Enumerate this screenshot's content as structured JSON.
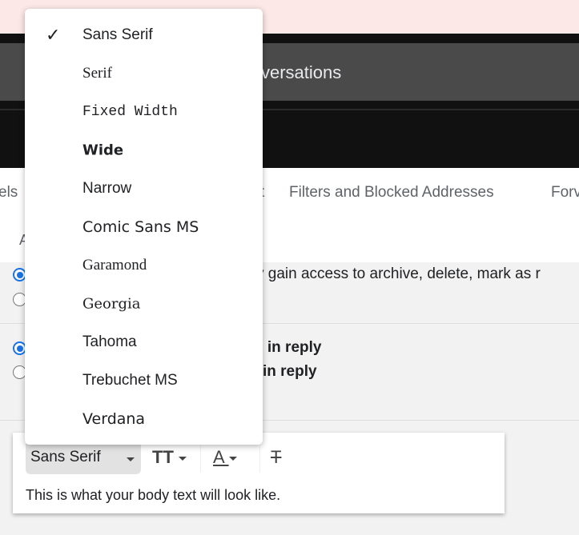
{
  "search": {
    "visible_text": "versations"
  },
  "tabs": [
    {
      "label": "els"
    },
    {
      "label": "t"
    },
    {
      "label": "Filters and Blocked Addresses"
    },
    {
      "label": "Forv"
    }
  ],
  "section": {
    "letter": "A"
  },
  "rows": {
    "r1": "y gain access to archive, delete, mark as r",
    "r2": "n in reply",
    "r3": " in reply"
  },
  "editor": {
    "font": "Sans Serif",
    "preview": "This is what your body text will look like.",
    "icons": [
      "text-size-icon",
      "text-color-icon",
      "remove-formatting-icon"
    ]
  },
  "menu": {
    "selected": "Sans Serif",
    "items": [
      "Sans Serif",
      "Serif",
      "Fixed Width",
      "Wide",
      "Narrow",
      "Comic Sans MS",
      "Garamond",
      "Georgia",
      "Tahoma",
      "Trebuchet MS",
      "Verdana"
    ]
  },
  "colors": {
    "accent": "#1a73e8",
    "banner": "#fce8e6",
    "header": "#111111"
  }
}
